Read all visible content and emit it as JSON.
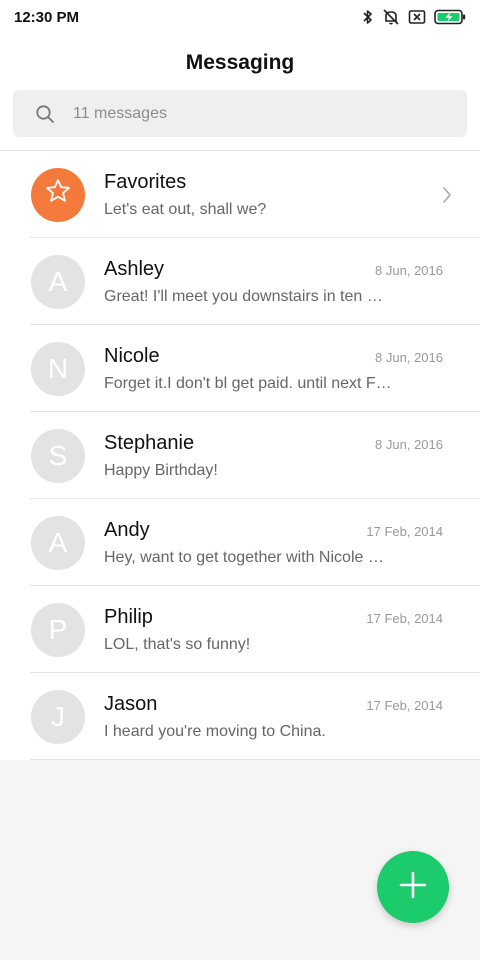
{
  "status_bar": {
    "time": "12:30 PM",
    "icons": [
      "bluetooth-icon",
      "muted-bell-icon",
      "no-sim-icon",
      "battery-charging-icon"
    ]
  },
  "header": {
    "title": "Messaging"
  },
  "search": {
    "placeholder": "11 messages",
    "icon": "search-icon"
  },
  "favorites": {
    "title": "Favorites",
    "preview": "Let's eat out, shall we?",
    "icon": "star-icon",
    "color": "#f47a3c"
  },
  "conversations": [
    {
      "initial": "A",
      "name": "Ashley",
      "date": "8 Jun, 2016",
      "preview": "Great! I'll meet you downstairs in ten …"
    },
    {
      "initial": "N",
      "name": "Nicole",
      "date": "8 Jun, 2016",
      "preview": "Forget it.I don't bl get paid. until next F…"
    },
    {
      "initial": "S",
      "name": "Stephanie",
      "date": "8 Jun, 2016",
      "preview": "Happy Birthday!"
    },
    {
      "initial": "A",
      "name": "Andy",
      "date": "17 Feb, 2014",
      "preview": "Hey, want to get together with Nicole …"
    },
    {
      "initial": "P",
      "name": "Philip",
      "date": "17 Feb, 2014",
      "preview": "LOL, that's so funny!"
    },
    {
      "initial": "J",
      "name": "Jason",
      "date": "17 Feb, 2014",
      "preview": "I heard you're moving to China."
    }
  ],
  "fab": {
    "icon": "plus-icon",
    "color": "#1ccb6c"
  }
}
